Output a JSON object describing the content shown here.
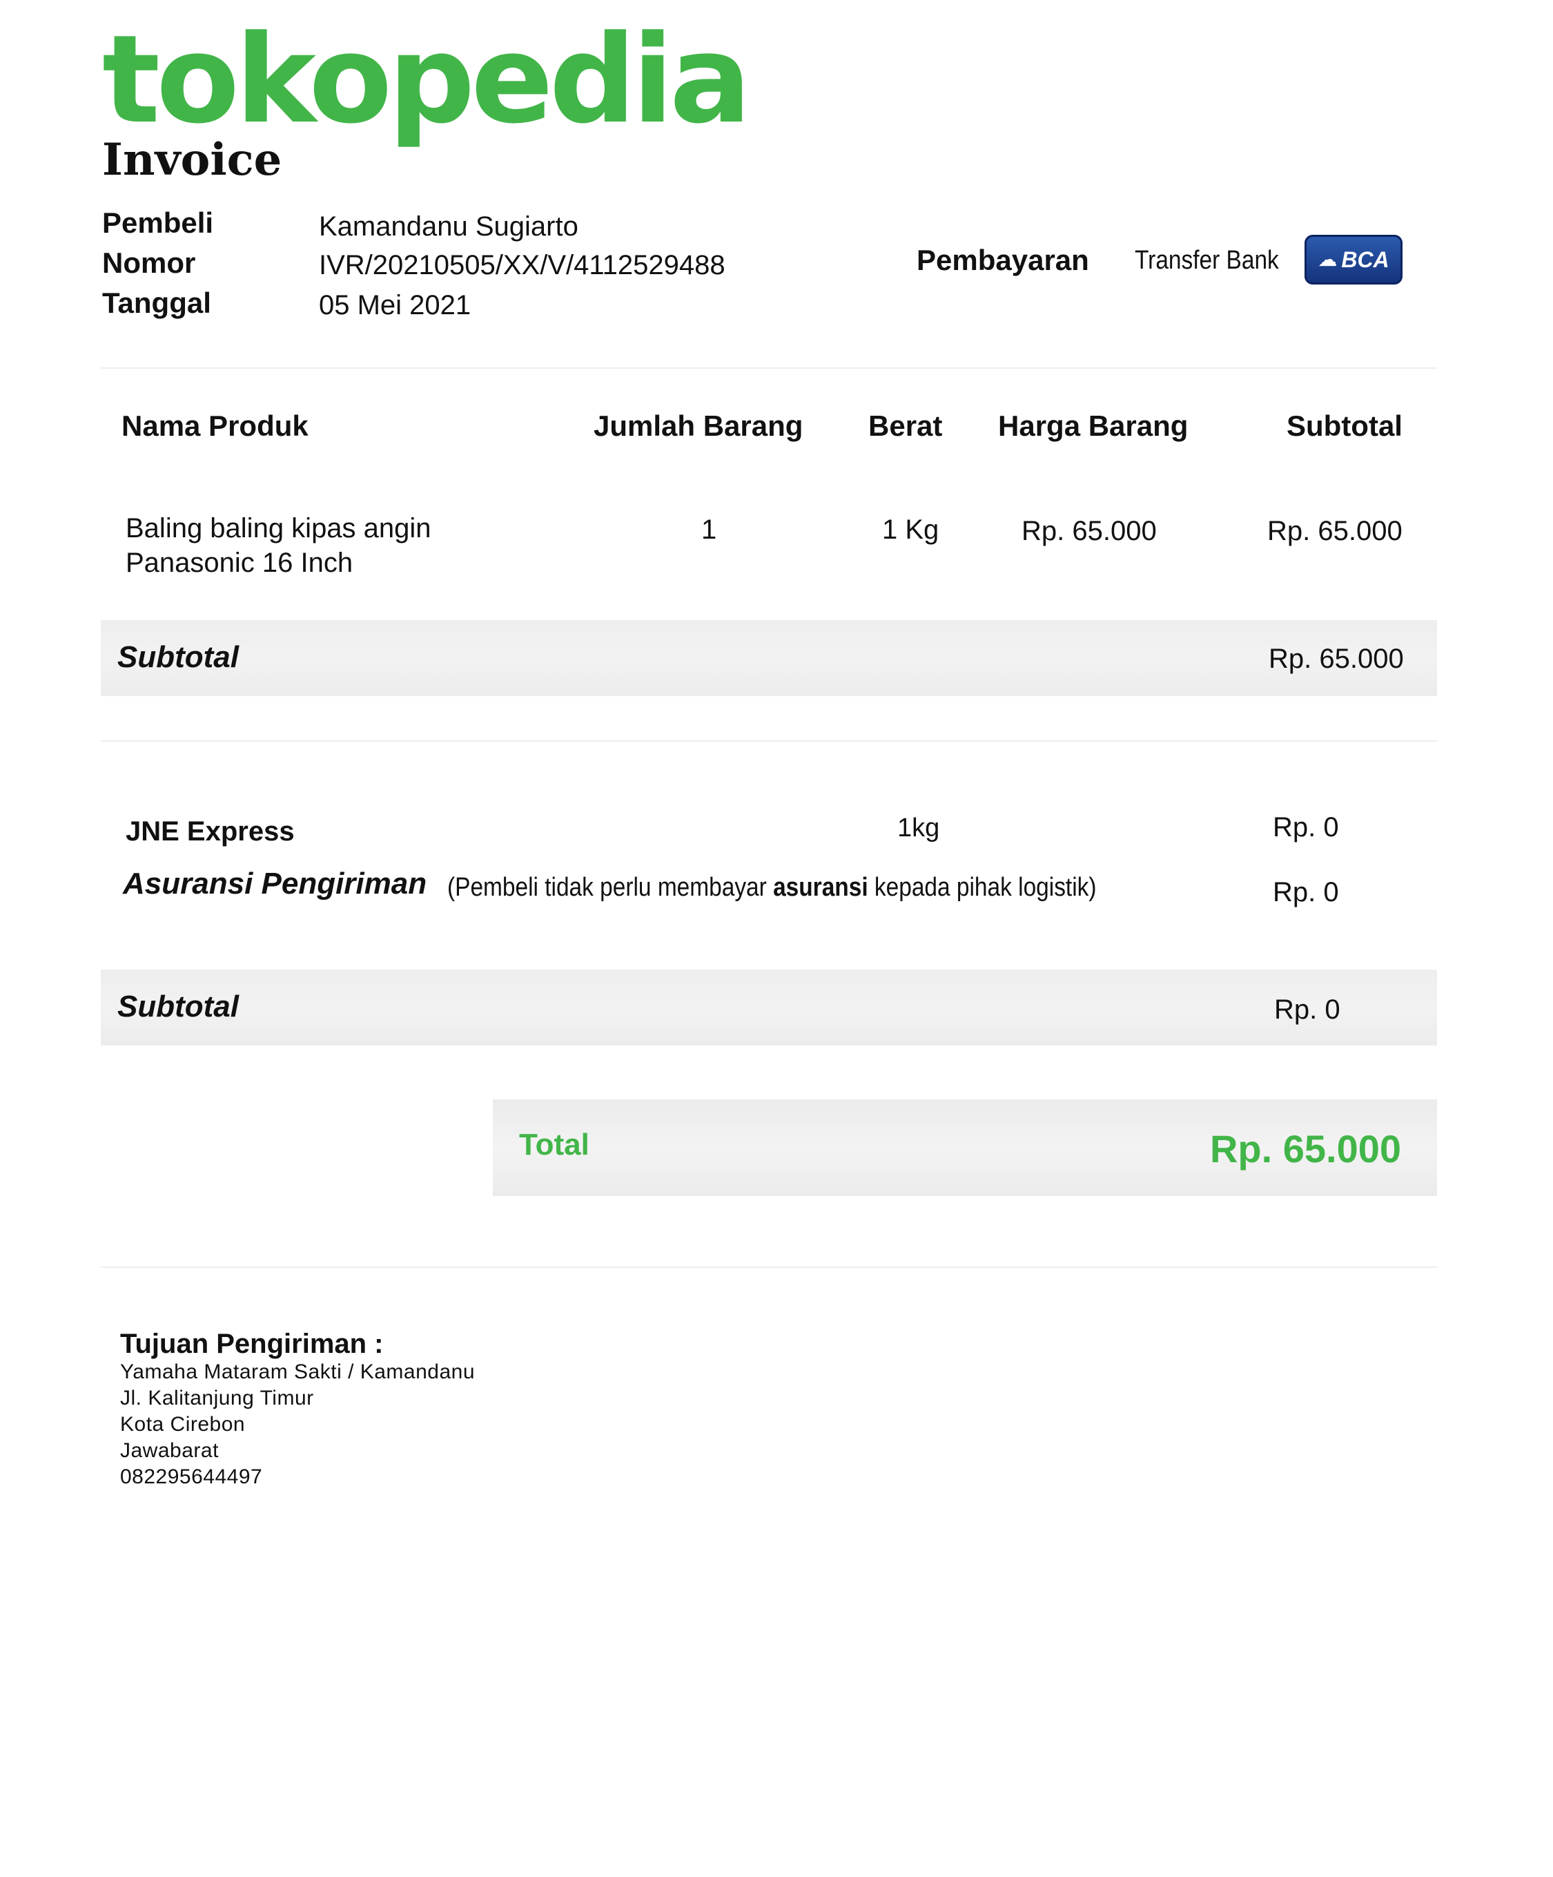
{
  "brand": {
    "logo_text": "tokopedia",
    "green": "#42b549"
  },
  "document": {
    "title": "Invoice"
  },
  "meta": {
    "buyer_label": "Pembeli",
    "buyer_value": "Kamandanu Sugiarto",
    "number_label": "Nomor",
    "number_value": "IVR/20210505/XX/V/4112529488",
    "date_label": "Tanggal",
    "date_value": "05 Mei 2021"
  },
  "payment": {
    "label": "Pembayaran",
    "method": "Transfer Bank",
    "bank_logo_text": "BCA",
    "bank_icon": "bca-logo-icon"
  },
  "products": {
    "headers": {
      "name": "Nama Produk",
      "qty": "Jumlah Barang",
      "weight": "Berat",
      "price": "Harga Barang",
      "subtotal": "Subtotal"
    },
    "rows": [
      {
        "name_line1": "Baling baling kipas angin",
        "name_line2": "Panasonic 16 Inch",
        "qty": "1",
        "weight": "1 Kg",
        "price": "Rp. 65.000",
        "subtotal": "Rp. 65.000"
      }
    ],
    "subtotal_label": "Subtotal",
    "subtotal_value": "Rp. 65.000"
  },
  "shipping": {
    "courier": "JNE Express",
    "weight": "1kg",
    "courier_cost": "Rp. 0",
    "insurance_label": "Asuransi Pengiriman",
    "insurance_note_pre": "(Pembeli tidak perlu membayar ",
    "insurance_note_bold": "asuransi",
    "insurance_note_post": " kepada pihak logistik)",
    "insurance_cost": "Rp. 0",
    "subtotal_label": "Subtotal",
    "subtotal_value": "Rp. 0"
  },
  "total": {
    "label": "Total",
    "value": "Rp. 65.000"
  },
  "destination": {
    "title": "Tujuan Pengiriman :",
    "lines": [
      "Yamaha Mataram Sakti / Kamandanu",
      "Jl. Kalitanjung Timur",
      "Kota Cirebon",
      "Jawabarat",
      "082295644497"
    ]
  }
}
